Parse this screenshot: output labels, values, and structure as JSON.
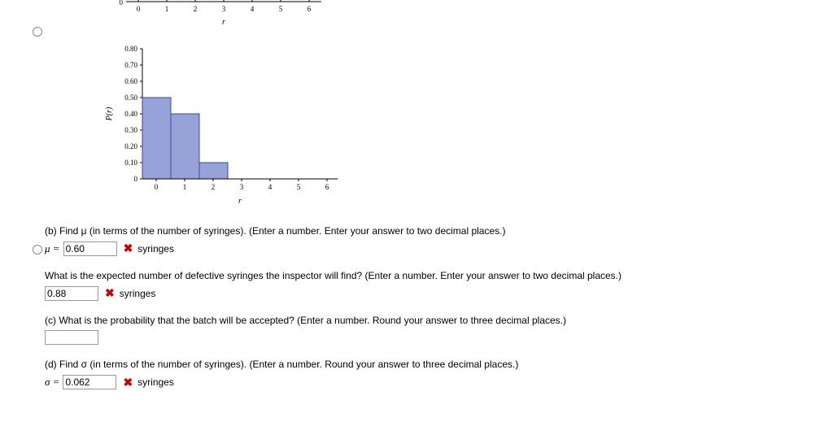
{
  "chart_data": [
    {
      "type": "bar",
      "partial": true,
      "categories": [
        0,
        1,
        2,
        3,
        4,
        5,
        6
      ],
      "xlabel": "r",
      "ylabel": "",
      "note": "only x-axis visible"
    },
    {
      "type": "bar",
      "categories": [
        0,
        1,
        2,
        3,
        4,
        5,
        6
      ],
      "values": [
        0.5,
        0.4,
        0.1,
        0,
        0,
        0,
        0
      ],
      "xlabel": "r",
      "ylabel": "P(r)",
      "ylim": [
        0,
        0.8
      ],
      "yticks": [
        0,
        0.1,
        0.2,
        0.3,
        0.4,
        0.5,
        0.6,
        0.7,
        0.8
      ],
      "bar_fill": "#97a3d8",
      "bar_stroke": "#3b4a9f"
    }
  ],
  "questions": {
    "b": {
      "prompt": "(b) Find μ (in terms of the number of syringes). (Enter a number. Enter your answer to two decimal places.)",
      "prefix": "μ = ",
      "value": "0.60",
      "mark": "wrong",
      "unit": "syringes"
    },
    "b2": {
      "prompt": "What is the expected number of defective syringes the inspector will find? (Enter a number. Enter your answer to two decimal places.)",
      "value": "0.88",
      "mark": "wrong",
      "unit": "syringes"
    },
    "c": {
      "prompt": "(c) What is the probability that the batch will be accepted? (Enter a number. Round your answer to three decimal places.)",
      "value": ""
    },
    "d": {
      "prompt": "(d) Find σ (in terms of the number of syringes). (Enter a number. Round your answer to three decimal places.)",
      "prefix": "σ = ",
      "value": "0.062",
      "mark": "wrong",
      "unit": "syringes"
    }
  },
  "icons": {
    "wrong": "✖"
  }
}
